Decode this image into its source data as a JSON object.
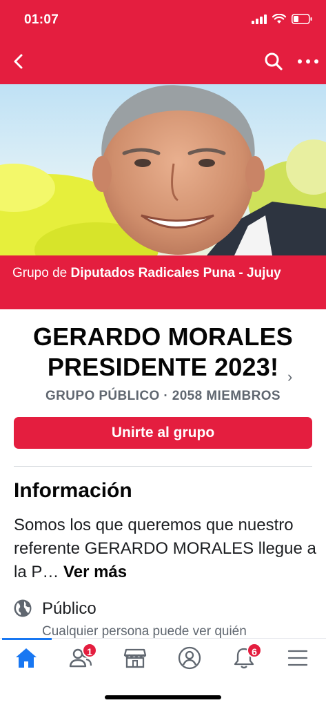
{
  "status_bar": {
    "time": "01:07"
  },
  "group": {
    "group_of_prefix": "Grupo de",
    "group_of_name": "Diputados Radicales Puna - Jujuy",
    "title_line1": "GERARDO MORALES",
    "title_line2": "PRESIDENTE 2023!",
    "meta": "GRUPO PÚBLICO · 2058 MIEMBROS",
    "join_label": "Unirte al grupo"
  },
  "info": {
    "heading": "Información",
    "text": "Somos los que queremos que nuestro referente GERARDO MORALES llegue a la P… ",
    "see_more": "Ver más",
    "privacy_label": "Público",
    "privacy_desc": "Cualquier persona puede ver quién"
  },
  "tab_bar": {
    "friends_badge": "1",
    "notifications_badge": "6"
  },
  "colors": {
    "brand": "#e41e3f",
    "active_tab": "#1877f2"
  },
  "icons": [
    "back-icon",
    "search-icon",
    "more-icon",
    "globe-icon",
    "home-icon",
    "friends-icon",
    "marketplace-icon",
    "profile-icon",
    "bell-icon",
    "menu-icon"
  ]
}
